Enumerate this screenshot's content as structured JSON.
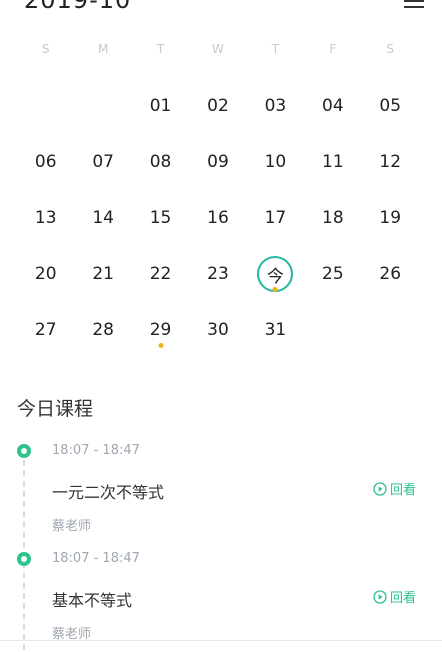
{
  "header": {
    "month_title": "2019-10"
  },
  "calendar": {
    "weekdays": [
      "S",
      "M",
      "T",
      "W",
      "T",
      "F",
      "S"
    ],
    "weeks": [
      [
        "",
        "",
        "01",
        "02",
        "03",
        "04",
        "05"
      ],
      [
        "06",
        "07",
        "08",
        "09",
        "10",
        "11",
        "12"
      ],
      [
        "13",
        "14",
        "15",
        "16",
        "17",
        "18",
        "19"
      ],
      [
        "20",
        "21",
        "22",
        "23",
        "今",
        "25",
        "26"
      ],
      [
        "27",
        "28",
        "29",
        "30",
        "31",
        "",
        ""
      ]
    ],
    "today_label": "今",
    "dot_days": [
      "今",
      "29"
    ]
  },
  "today": {
    "title": "今日课程",
    "courses": [
      {
        "time": "18:07 - 18:47",
        "name": "一元二次不等式",
        "teacher": "蔡老师",
        "action": "回看"
      },
      {
        "time": "18:07 - 18:47",
        "name": "基本不等式",
        "teacher": "蔡老师",
        "action": "回看"
      }
    ]
  },
  "colors": {
    "accent": "#2cc28a",
    "today_ring": "#23b8a0",
    "event_dot": "#f2b21c"
  },
  "icons": {
    "menu": "menu-icon",
    "play": "play-circle-icon",
    "timeline_node": "timeline-node-icon"
  }
}
